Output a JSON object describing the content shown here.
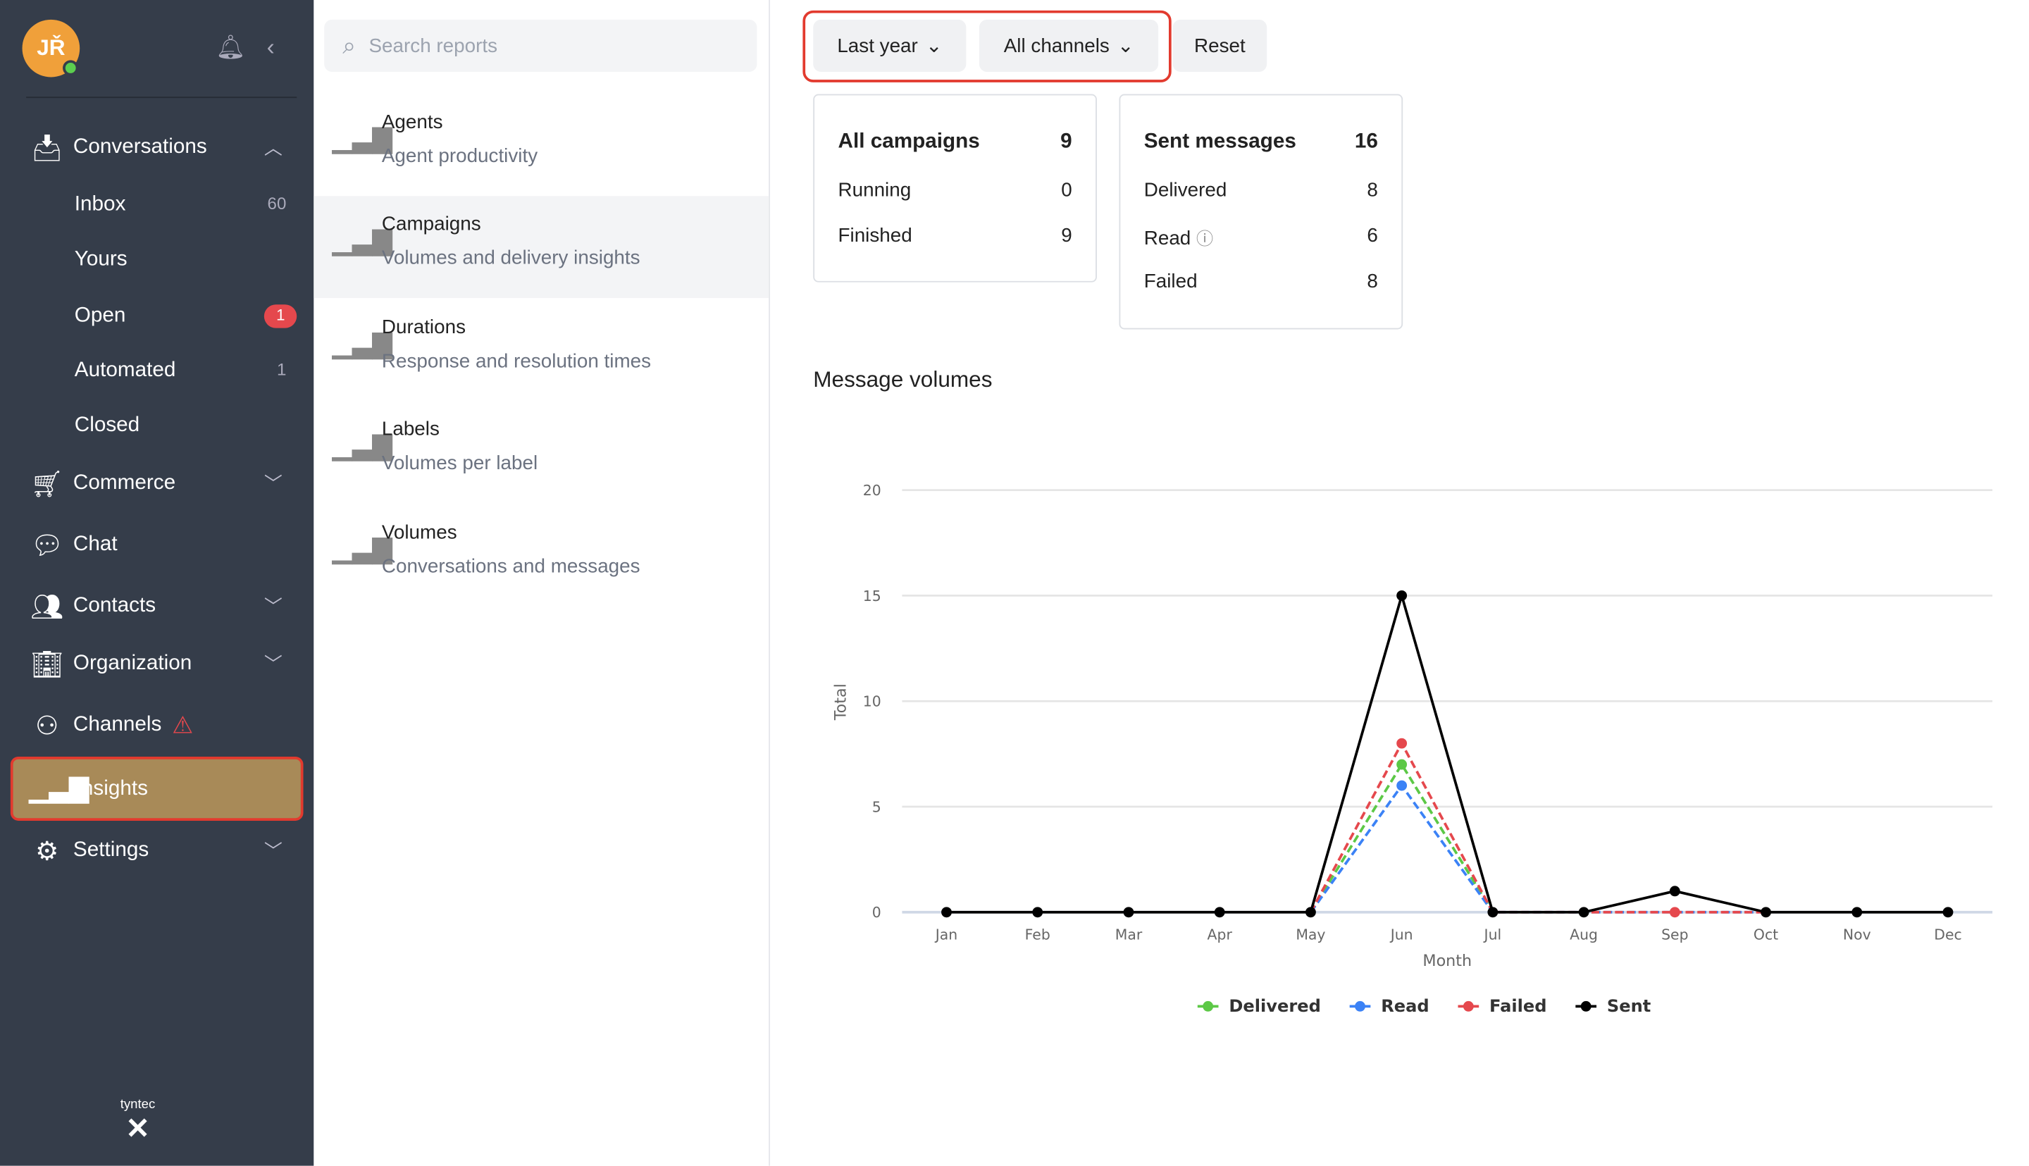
{
  "sidebar": {
    "avatar_initials": "JŘ",
    "items": [
      {
        "label": "Conversations",
        "icon": "inbox-download-icon"
      },
      {
        "label": "Commerce",
        "icon": "cart-icon"
      },
      {
        "label": "Chat",
        "icon": "chat-bubble-icon"
      },
      {
        "label": "Contacts",
        "icon": "people-icon"
      },
      {
        "label": "Organization",
        "icon": "building-icon"
      },
      {
        "label": "Channels",
        "icon": "channels-icon"
      },
      {
        "label": "Insights",
        "icon": "bar-chart-icon"
      },
      {
        "label": "Settings",
        "icon": "gear-icon"
      }
    ],
    "conversation_subitems": [
      {
        "label": "Inbox",
        "count": "60"
      },
      {
        "label": "Yours",
        "count": ""
      },
      {
        "label": "Open",
        "count": "1"
      },
      {
        "label": "Automated",
        "count": "1"
      },
      {
        "label": "Closed",
        "count": ""
      }
    ],
    "logo": "tyntec"
  },
  "reports": {
    "search_placeholder": "Search reports",
    "items": [
      {
        "title": "Agents",
        "subtitle": "Agent productivity"
      },
      {
        "title": "Campaigns",
        "subtitle": "Volumes and delivery insights"
      },
      {
        "title": "Durations",
        "subtitle": "Response and resolution times"
      },
      {
        "title": "Labels",
        "subtitle": "Volumes per label"
      },
      {
        "title": "Volumes",
        "subtitle": "Conversations and messages"
      }
    ]
  },
  "filters": {
    "period": "Last year",
    "channels": "All channels",
    "reset": "Reset"
  },
  "campaigns_card": {
    "title": "All campaigns",
    "total": "9",
    "rows": [
      {
        "label": "Running",
        "value": "0"
      },
      {
        "label": "Finished",
        "value": "9"
      }
    ]
  },
  "messages_card": {
    "title": "Sent messages",
    "total": "16",
    "rows": [
      {
        "label": "Delivered",
        "value": "8"
      },
      {
        "label": "Read",
        "value": "6"
      },
      {
        "label": "Failed",
        "value": "8"
      }
    ]
  },
  "section_title": "Message volumes",
  "chart_data": {
    "type": "line",
    "xlabel": "Month",
    "ylabel": "Total",
    "categories": [
      "Jan",
      "Feb",
      "Mar",
      "Apr",
      "May",
      "Jun",
      "Jul",
      "Aug",
      "Sep",
      "Oct",
      "Nov",
      "Dec"
    ],
    "ylim": [
      0,
      20
    ],
    "yticks": [
      0,
      5,
      10,
      15,
      20
    ],
    "grid": true,
    "legend": "bottom",
    "series": [
      {
        "name": "Delivered",
        "color": "#5cc846",
        "dashed": true,
        "values": [
          null,
          null,
          null,
          null,
          0,
          7,
          0,
          null,
          null,
          null,
          null,
          null
        ]
      },
      {
        "name": "Read",
        "color": "#3b82f6",
        "dashed": true,
        "values": [
          null,
          null,
          null,
          null,
          0,
          6,
          0,
          0,
          0,
          0,
          null,
          null
        ]
      },
      {
        "name": "Failed",
        "color": "#e5484d",
        "dashed": true,
        "values": [
          null,
          null,
          null,
          null,
          0,
          8,
          0,
          0,
          0,
          0,
          null,
          null
        ]
      },
      {
        "name": "Sent",
        "color": "#000000",
        "dashed": false,
        "values": [
          0,
          0,
          0,
          0,
          0,
          15,
          0,
          0,
          1,
          0,
          0,
          0
        ]
      }
    ]
  }
}
